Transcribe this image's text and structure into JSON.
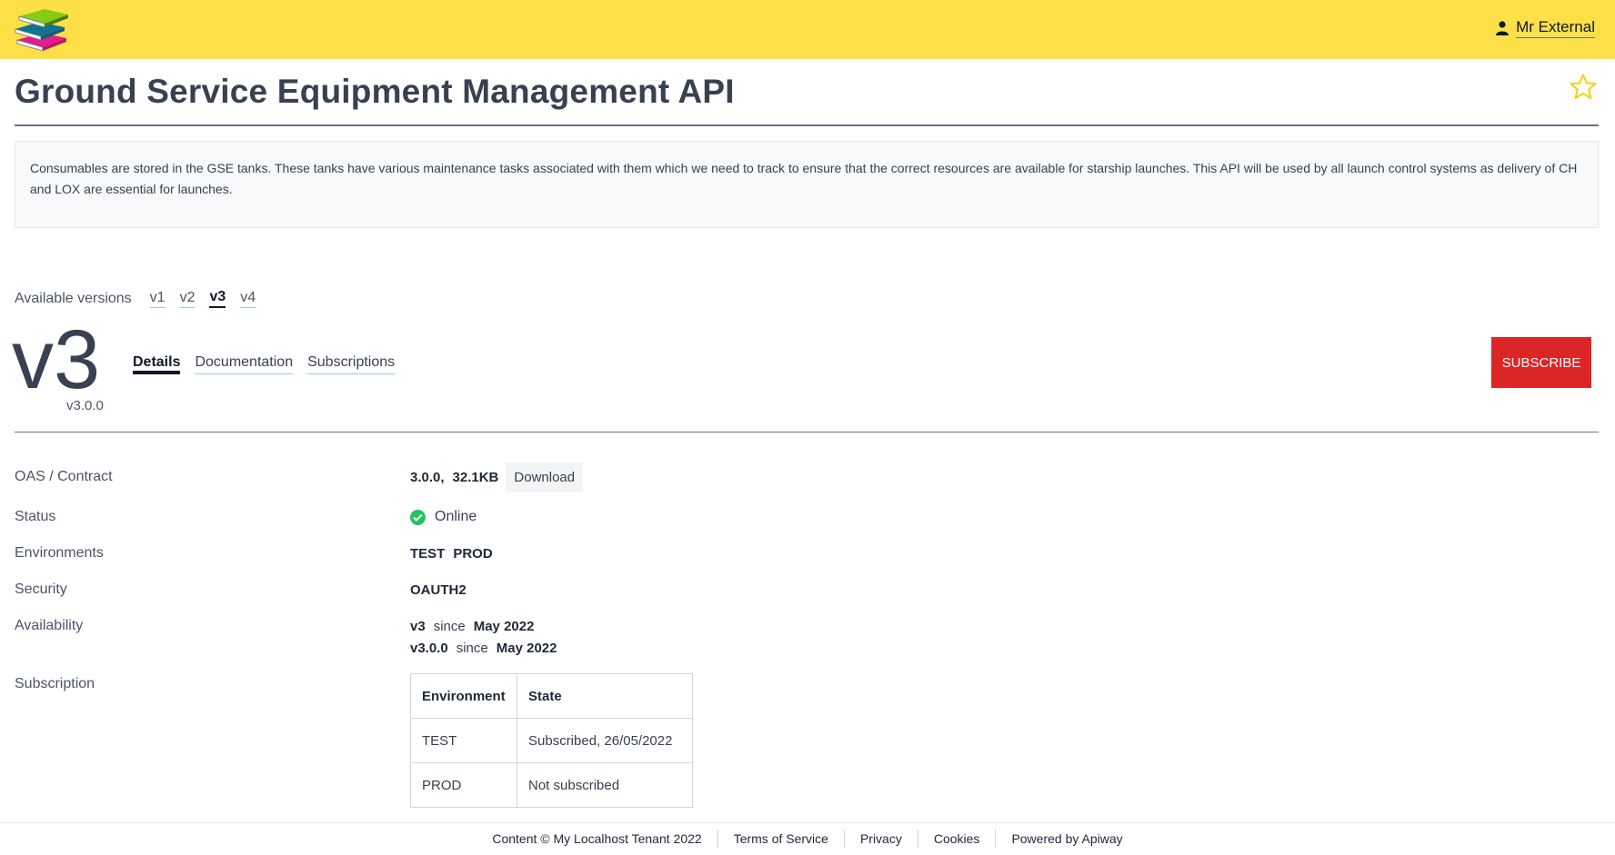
{
  "header": {
    "user_name": "Mr External",
    "logo_icon": "books-icon",
    "user_icon": "person-icon",
    "background_color": "#fde047"
  },
  "page": {
    "title": "Ground Service Equipment Management API",
    "description": "Consumables are stored in the GSE tanks. These tanks have various maintenance tasks associated with them which we need to track to ensure that the correct resources are available for starship launches. This API will be used by all launch control systems as delivery of CH and LOX are essential for launches.",
    "favorite_icon": "star-outline-icon"
  },
  "versions": {
    "label": "Available versions",
    "items": [
      "v1",
      "v2",
      "v3",
      "v4"
    ],
    "selected": "v3"
  },
  "current_version": {
    "major": "v3",
    "full": "v3.0.0"
  },
  "tabs": [
    {
      "label": "Details",
      "active": true
    },
    {
      "label": "Documentation",
      "active": false
    },
    {
      "label": "Subscriptions",
      "active": false
    }
  ],
  "subscribe_label": "SUBSCRIBE",
  "subscribe_color": "#dc2626",
  "details": {
    "oas_label": "OAS / Contract",
    "oas_version": "3.0.0,",
    "oas_size": "32.1KB",
    "download_label": "Download",
    "status_label": "Status",
    "status_value": "Online",
    "status_color": "#22c55e",
    "environments_label": "Environments",
    "environments": [
      "TEST",
      "PROD"
    ],
    "security_label": "Security",
    "security_value": "OAUTH2",
    "availability_label": "Availability",
    "availability": [
      {
        "version": "v3",
        "since": "since",
        "date": "May 2022"
      },
      {
        "version": "v3.0.0",
        "since": "since",
        "date": "May 2022"
      }
    ],
    "subscription_label": "Subscription",
    "subscription_table": {
      "headers": [
        "Environment",
        "State"
      ],
      "rows": [
        [
          "TEST",
          "Subscribed, 26/05/2022"
        ],
        [
          "PROD",
          "Not subscribed"
        ]
      ]
    }
  },
  "footer": {
    "items": [
      "Content © My Localhost Tenant 2022",
      "Terms of Service",
      "Privacy",
      "Cookies",
      "Powered by Apiway"
    ]
  }
}
